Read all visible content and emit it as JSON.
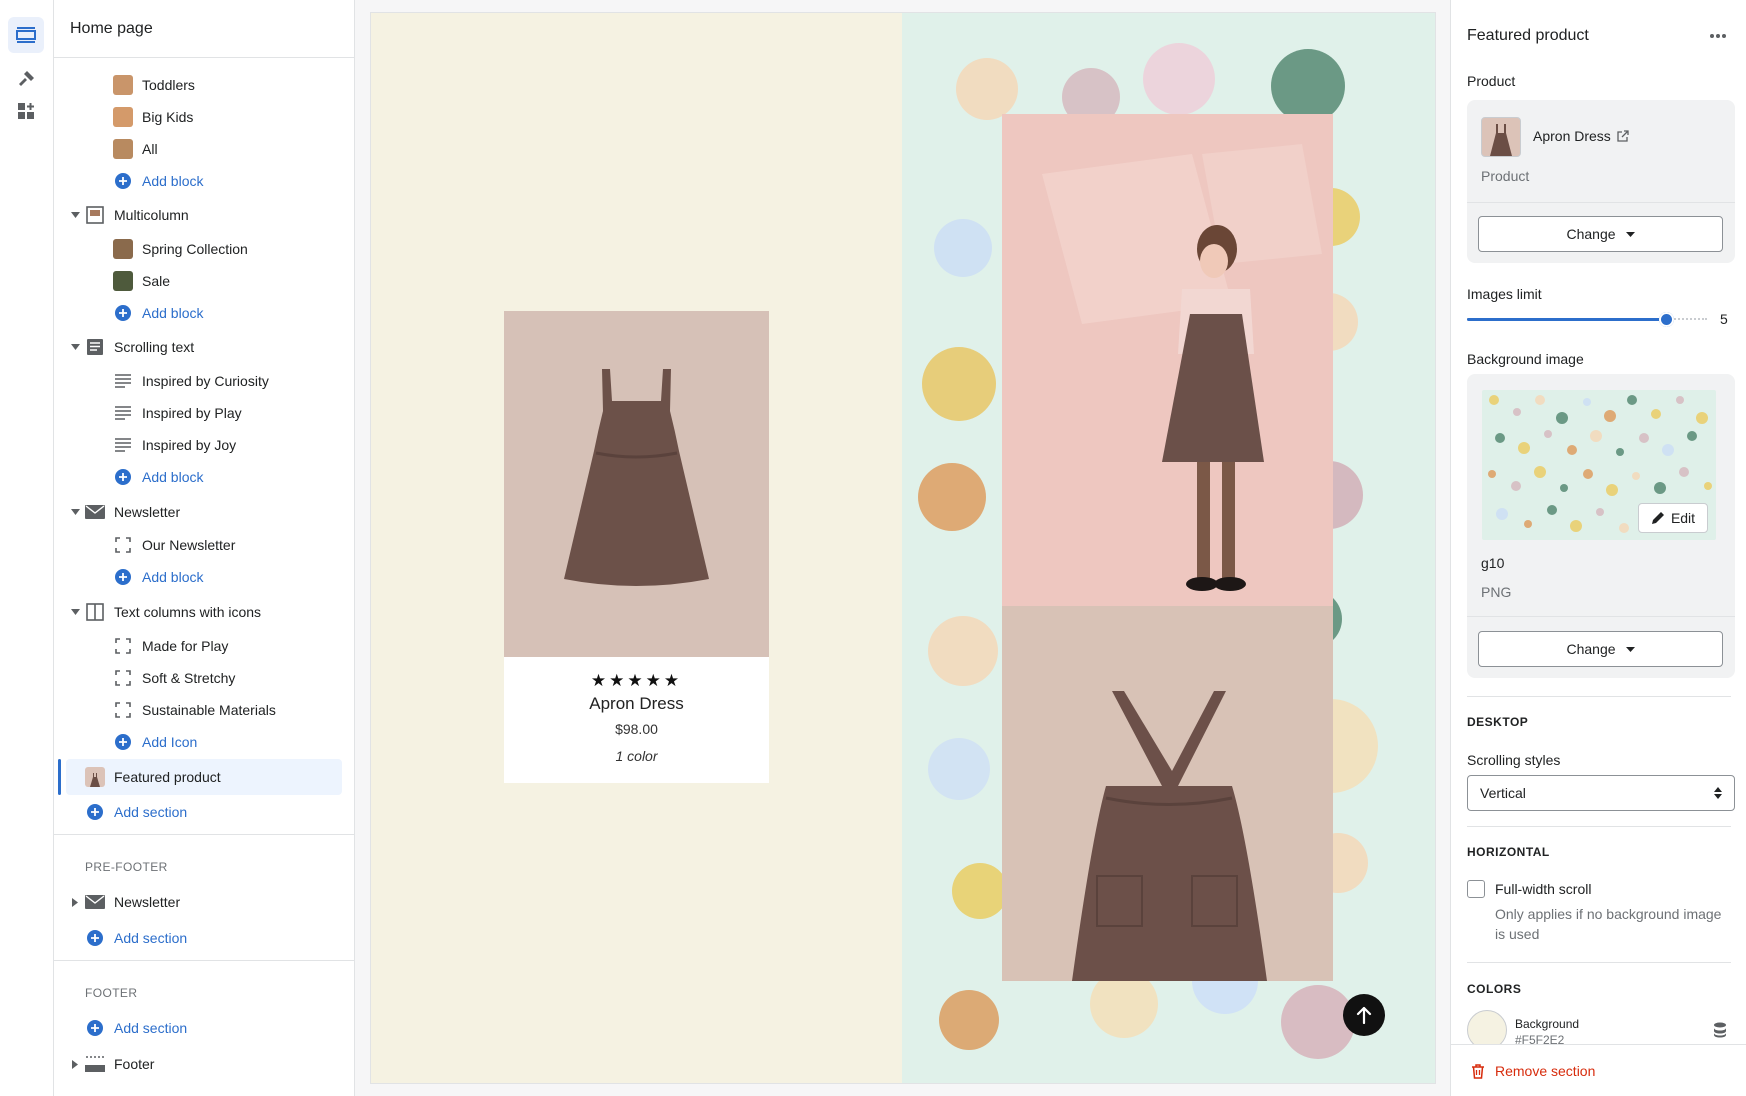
{
  "page_title": "Home page",
  "rail": {
    "icons": [
      "sections-icon",
      "theme-settings-icon",
      "app-embeds-icon"
    ]
  },
  "tree": {
    "toddlers": "Toddlers",
    "big_kids": "Big Kids",
    "all": "All",
    "add_block": "Add block",
    "multicolumn": "Multicolumn",
    "spring_collection": "Spring Collection",
    "sale": "Sale",
    "scrolling_text": "Scrolling text",
    "inspired_curiosity": "Inspired by Curiosity",
    "inspired_play": "Inspired by Play",
    "inspired_joy": "Inspired by Joy",
    "newsletter": "Newsletter",
    "our_newsletter": "Our Newsletter",
    "text_columns": "Text columns with icons",
    "made_for_play": "Made for Play",
    "soft_stretchy": "Soft & Stretchy",
    "sustainable": "Sustainable Materials",
    "add_icon": "Add Icon",
    "featured_product": "Featured product",
    "add_section": "Add section",
    "pre_footer_title": "PRE-FOOTER",
    "pre_footer_newsletter": "Newsletter",
    "footer_title": "FOOTER",
    "footer": "Footer"
  },
  "preview": {
    "card": {
      "stars": "★★★★★",
      "title": "Apron Dress",
      "price": "$98.00",
      "colors": "1 color"
    },
    "colors": {
      "left_bg": "#F5F2E2",
      "right_bg": "#E0F1EA"
    }
  },
  "settings": {
    "title": "Featured product",
    "more_icon": "more-horizontal-icon",
    "product_label": "Product",
    "product_name": "Apron Dress",
    "product_type": "Product",
    "change_label": "Change",
    "images_limit_label": "Images limit",
    "images_limit_value": "5",
    "images_limit_fraction": 0.83,
    "background_image_label": "Background image",
    "edit_label": "Edit",
    "image_name": "g10",
    "image_type": "PNG",
    "desktop_title": "DESKTOP",
    "scrolling_styles_label": "Scrolling styles",
    "scrolling_styles_value": "Vertical",
    "horizontal_title": "HORIZONTAL",
    "full_width_label": "Full-width scroll",
    "full_width_help": "Only applies if no background image is used",
    "colors_title": "COLORS",
    "background_label": "Background",
    "background_value": "#F5F2E2",
    "remove_section": "Remove section"
  }
}
